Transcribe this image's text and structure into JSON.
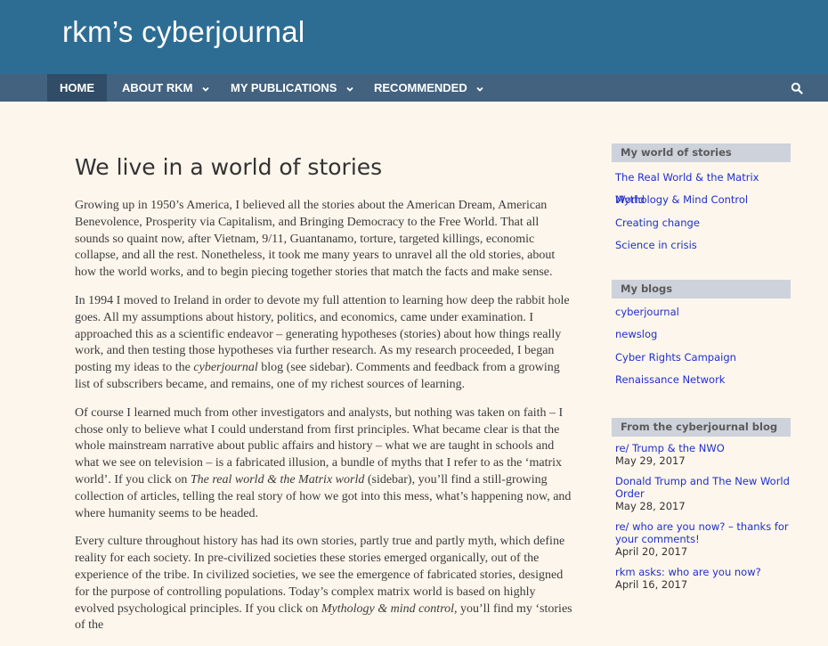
{
  "site": {
    "title": "rkm’s cyberjournal"
  },
  "nav": {
    "items": [
      {
        "label": "HOME"
      },
      {
        "label": "ABOUT RKM"
      },
      {
        "label": "MY PUBLICATIONS"
      },
      {
        "label": "RECOMMENDED"
      }
    ],
    "search_icon": "search-icon"
  },
  "main": {
    "title": "We live in a world of stories",
    "p1": "Growing up in 1950’s America, I believed all the stories about the American Dream, American Benevolence, Prosperity via Capitalism, and Bringing Democracy to the Free World. That all sounds so quaint now, after Vietnam, 9/11, Guantanamo, torture, targeted killings, economic collapse, and all the rest. Nonetheless, it took me many years to unravel all the old stories, about how the world works, and to begin piecing together stories that match the facts and make sense.",
    "p2a": "In 1994 I moved to Ireland in order to devote my full attention to learning how deep the rabbit hole goes. All my assumptions about history, politics, and economics, came under examination. I approached this as a scientific endeavor – generating hypotheses (stories) about how things really work, and then testing those hypotheses via further research. As my research proceeded, I began posting my ideas to the ",
    "p2_em": "cyberjournal",
    "p2b": " blog (see sidebar). Comments and feedback from a growing list of subscribers became, and remains, one of my richest sources of learning.",
    "p3a": "Of course I learned much from other investigators and analysts, but nothing was taken on faith – I chose only to believe what I could understand from first principles. What became clear is that the whole mainstream narrative about public affairs and history – what we are taught in schools and what we see on television – is a fabricated illusion, a bundle of myths that I refer to as the ‘matrix world’. If you click on ",
    "p3_em": "The real world & the Matrix world",
    "p3b": " (sidebar), you’ll find a still-growing collection of articles, telling the real story of how we got into this mess, what’s happening now, and where humanity seems to be headed.",
    "p4a": "Every culture throughout history has had its own stories, partly true and partly myth, which define reality for each society. In pre-civilized societies these stories emerged organically, out of the experience of the tribe. In civilized societies, we see the emergence of fabricated stories, designed for the purpose of controlling populations. Today’s complex matrix world is based on highly evolved psychological principles. If you click on ",
    "p4_em": "Mythology & mind control",
    "p4b": ", you’ll find my ‘stories of the"
  },
  "sidebar": {
    "stories": {
      "title": "My world of stories",
      "links": [
        "The Real World & the Matrix World",
        "Mythology & Mind Control",
        "Creating change",
        "Science in crisis"
      ]
    },
    "blogs": {
      "title": "My blogs",
      "links": [
        "cyberjournal",
        "newslog",
        "Cyber Rights Campaign",
        "Renaissance Network"
      ]
    },
    "recent": {
      "title": "From the cyberjournal blog",
      "posts": [
        {
          "title": "re/ Trump & the NWO",
          "date": "May 29, 2017"
        },
        {
          "title": "Donald Trump and The New World Order",
          "date": "May 28, 2017"
        },
        {
          "title": "re/ who are you now? – thanks for your comments!",
          "date": "April 20, 2017"
        },
        {
          "title": "rkm asks: who are you now?",
          "date": "April 16, 2017"
        }
      ]
    }
  },
  "colors": {
    "masthead": "#2e6d93",
    "navbar": "#42627f",
    "nav_active": "#314c66",
    "link": "#1f2fcc",
    "background": "#fdf6ec"
  }
}
